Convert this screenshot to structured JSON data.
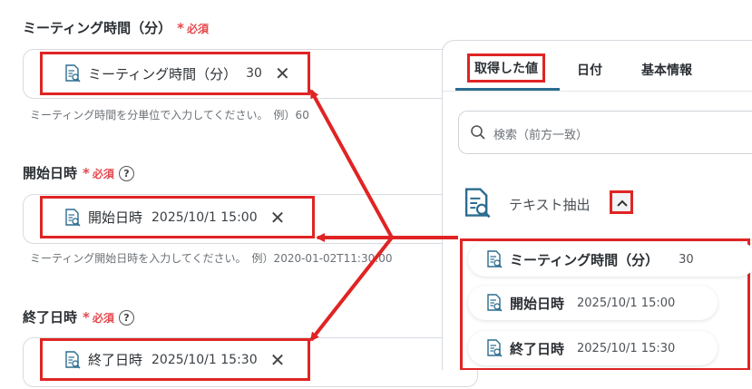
{
  "fields": [
    {
      "label": "ミーティング時間（分）",
      "required": "必須",
      "has_help": false,
      "chip_label": "ミーティング時間（分）",
      "chip_value": "30",
      "hint": "ミーティング時間を分単位で入力してください。　例）60"
    },
    {
      "label": "開始日時",
      "required": "必須",
      "has_help": true,
      "chip_label": "開始日時",
      "chip_value": "2025/10/1 15:00",
      "hint": "ミーティング開始日時を入力してください。　例）2020-01-02T11:30:00"
    },
    {
      "label": "終了日時",
      "required": "必須",
      "has_help": true,
      "chip_label": "終了日時",
      "chip_value": "2025/10/1 15:30",
      "hint": ""
    }
  ],
  "help_glyph": "?",
  "close_glyph": "✕",
  "panel": {
    "tabs": [
      "取得した値",
      "日付",
      "基本情報"
    ],
    "search_placeholder": "検索（前方一致）",
    "group_title": "テキスト抽出",
    "items": [
      {
        "name": "ミーティング時間（分）",
        "value": "30"
      },
      {
        "name": "開始日時",
        "value": "2025/10/1 15:00"
      },
      {
        "name": "終了日時",
        "value": "2025/10/1 15:30"
      }
    ]
  },
  "colors": {
    "accent": "#2b6c8f",
    "highlight": "#e02424",
    "required": "#e5484d"
  }
}
